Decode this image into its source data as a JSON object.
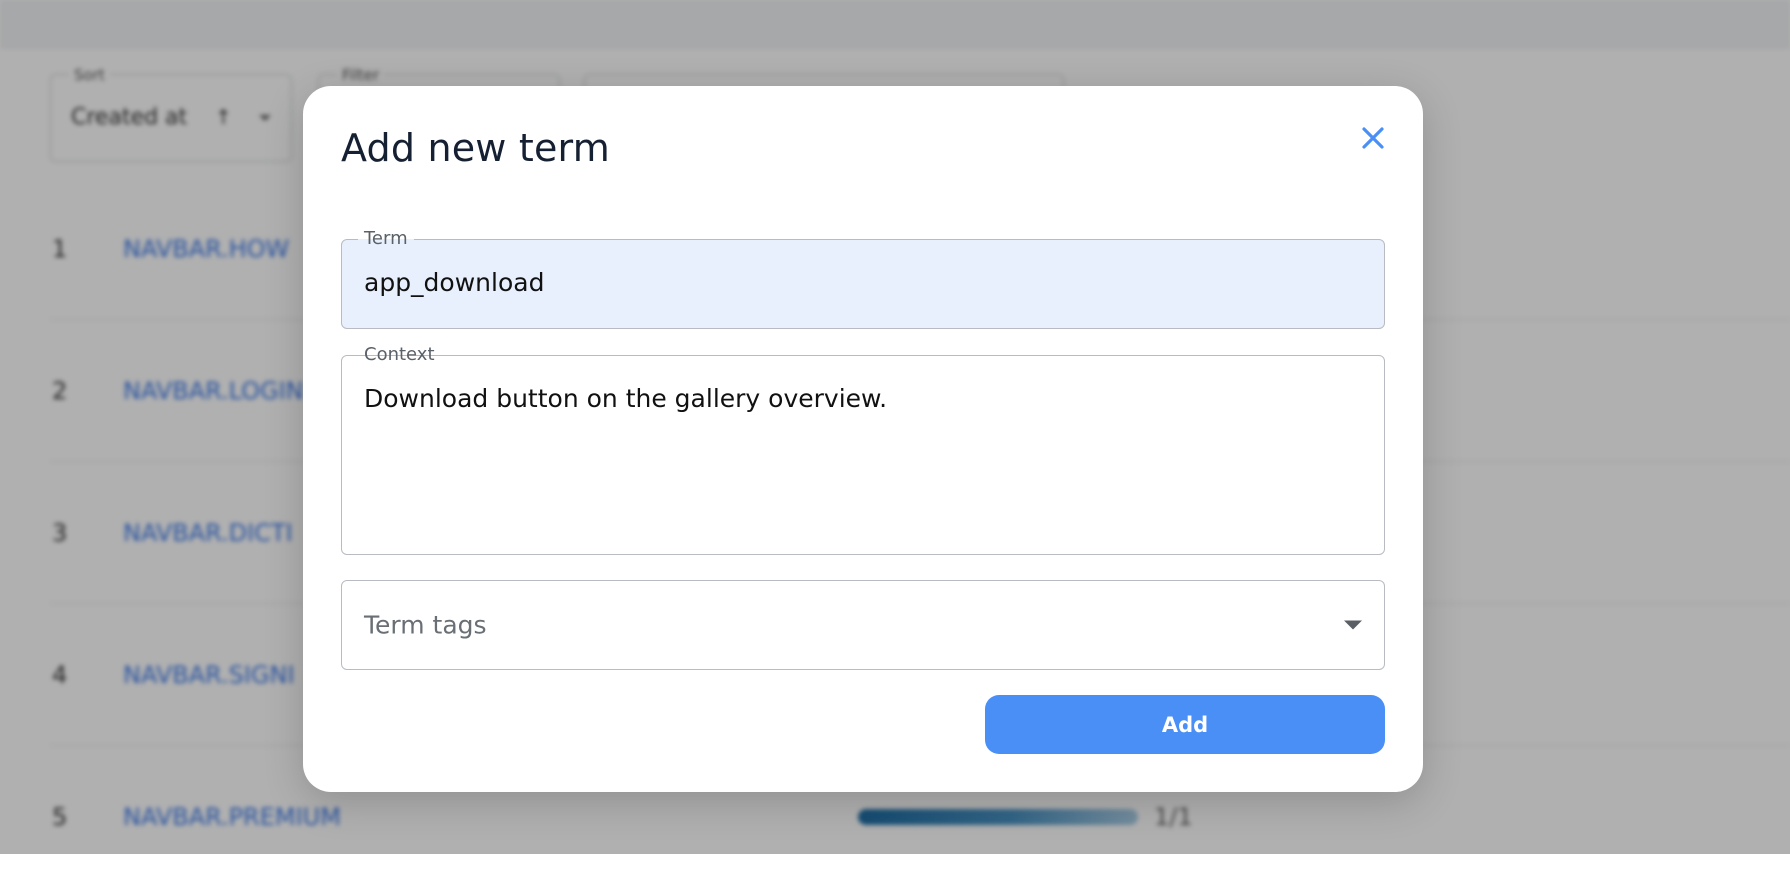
{
  "background": {
    "sort": {
      "label": "Sort",
      "value": "Created at",
      "direction_icon": "arrow-direction-icon"
    },
    "filter": {
      "label": "Filter"
    },
    "rows": [
      {
        "index": "1",
        "key": "NAVBAR.HOW"
      },
      {
        "index": "2",
        "key": "NAVBAR.LOGIN"
      },
      {
        "index": "3",
        "key": "NAVBAR.DICTI"
      },
      {
        "index": "4",
        "key": "NAVBAR.SIGNI"
      },
      {
        "index": "5",
        "key": "NAVBAR.PREMIUM",
        "progress_label": "1/1",
        "progress": 1.0
      }
    ]
  },
  "dialog": {
    "title": "Add new term",
    "close_icon": "close-icon",
    "term": {
      "label": "Term",
      "value": "app_download"
    },
    "context": {
      "label": "Context",
      "value": "Download button on the gallery overview."
    },
    "tags": {
      "placeholder": "Term tags"
    },
    "add_label": "Add"
  },
  "colors": {
    "accent": "#4a8ff5",
    "term_field_bg": "#e8effd",
    "link": "#3b78e7",
    "title": "#152033"
  }
}
